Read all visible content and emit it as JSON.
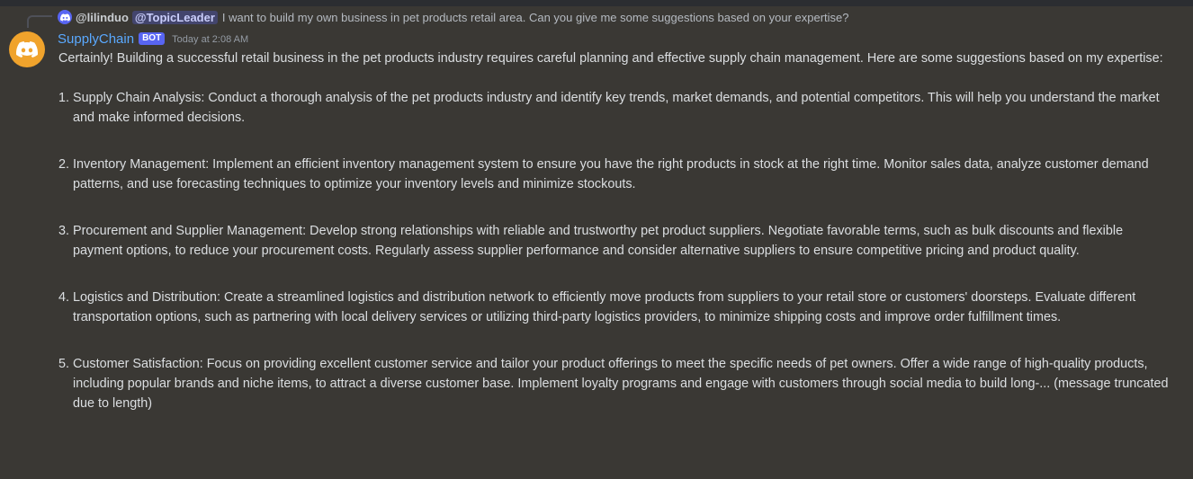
{
  "reply": {
    "user": "@lilinduo",
    "mention": "@TopicLeader",
    "text": "I want to build my own business in pet products retail area. Can you give me some suggestions based on your expertise?"
  },
  "message": {
    "username": "SupplyChain",
    "bot_tag": "BOT",
    "timestamp": "Today at 2:08 AM",
    "intro": "Certainly! Building a successful retail business in the pet products industry requires careful planning and effective supply chain management. Here are some suggestions based on my expertise:",
    "items": [
      {
        "num": "1.",
        "text": "Supply Chain Analysis: Conduct a thorough analysis of the pet products industry and identify key trends, market demands, and potential competitors. This will help you understand the market and make informed decisions."
      },
      {
        "num": "2.",
        "text": "Inventory Management: Implement an efficient inventory management system to ensure you have the right products in stock at the right time. Monitor sales data, analyze customer demand patterns, and use forecasting techniques to optimize your inventory levels and minimize stockouts."
      },
      {
        "num": "3.",
        "text": "Procurement and Supplier Management: Develop strong relationships with reliable and trustworthy pet product suppliers. Negotiate favorable terms, such as bulk discounts and flexible payment options, to reduce your procurement costs. Regularly assess supplier performance and consider alternative suppliers to ensure competitive pricing and product quality."
      },
      {
        "num": "4.",
        "text": "Logistics and Distribution: Create a streamlined logistics and distribution network to efficiently move products from suppliers to your retail store or customers' doorsteps. Evaluate different transportation options, such as partnering with local delivery services or utilizing third-party logistics providers, to minimize shipping costs and improve order fulfillment times."
      },
      {
        "num": "5.",
        "text": "Customer Satisfaction: Focus on providing excellent customer service and tailor your product offerings to meet the specific needs of pet owners. Offer a wide range of high-quality products, including popular brands and niche items, to attract a diverse customer base. Implement loyalty programs and engage with customers through social media to build long-... (message truncated due to length)"
      }
    ]
  },
  "colors": {
    "background": "#3a3834",
    "username": "#5aa9ff",
    "bot_tag": "#5865f2",
    "avatar": "#f0a32c"
  },
  "icons": {
    "avatar": "discord-logo-icon",
    "reply_avatar": "discord-logo-icon"
  }
}
